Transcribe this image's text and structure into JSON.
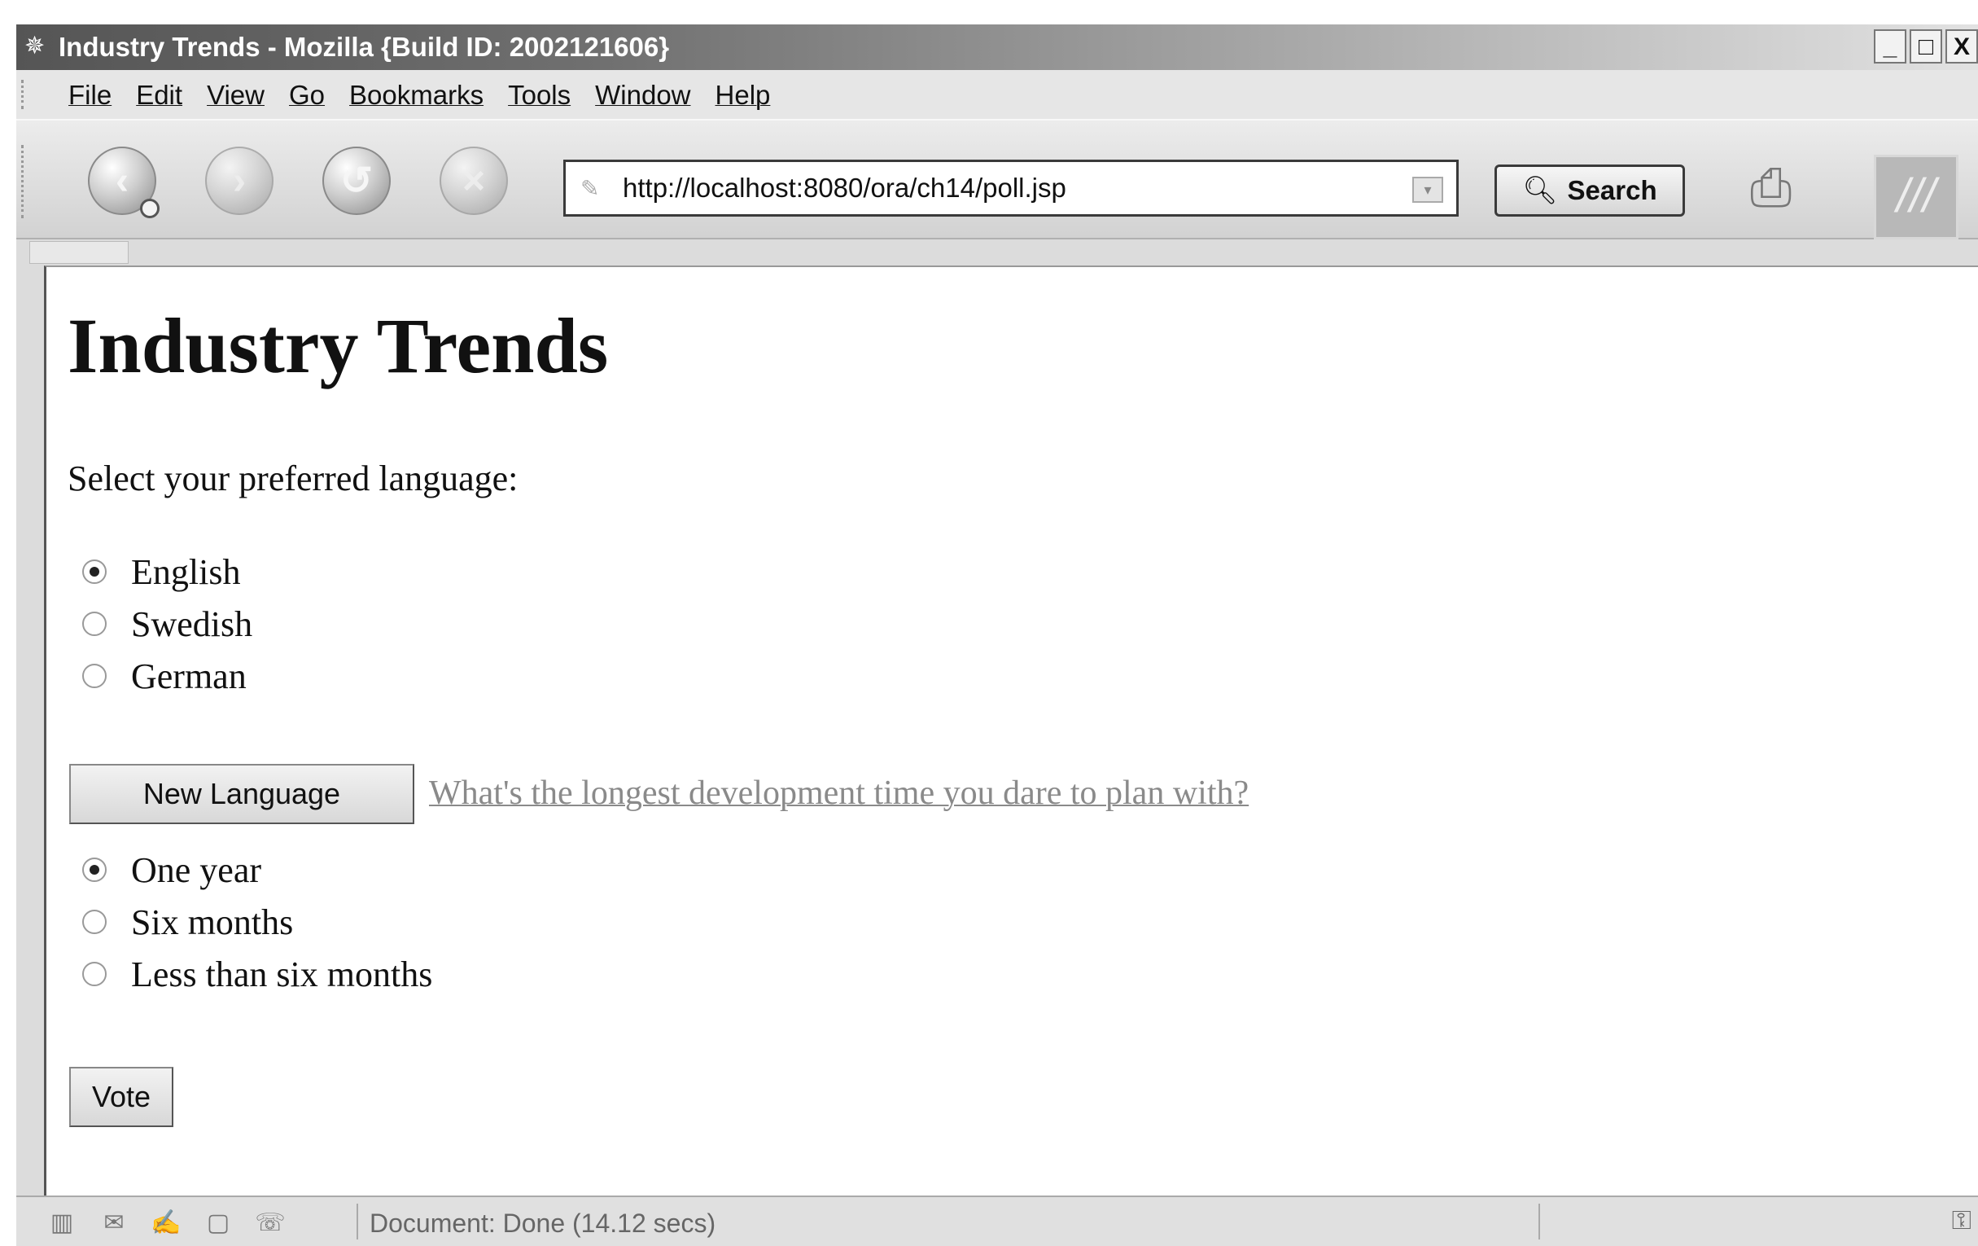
{
  "window": {
    "title": "Industry Trends - Mozilla {Build ID: 2002121606}",
    "minimize": "_",
    "maximize": "□",
    "close": "X"
  },
  "menu": [
    "File",
    "Edit",
    "View",
    "Go",
    "Bookmarks",
    "Tools",
    "Window",
    "Help"
  ],
  "toolbar": {
    "url": "http://localhost:8080/ora/ch14/poll.jsp",
    "search_label": "Search",
    "icons": [
      "back-icon",
      "forward-icon",
      "reload-icon",
      "stop-icon",
      "print-icon",
      "throbber-icon"
    ]
  },
  "page": {
    "heading": "Industry Trends",
    "language_prompt": "Select your preferred language:",
    "languages": [
      {
        "label": "English",
        "checked": true
      },
      {
        "label": "Swedish",
        "checked": false
      },
      {
        "label": "German",
        "checked": false
      }
    ],
    "new_language_button": "New Language",
    "question_link": "What's the longest development time you dare to plan with?",
    "time_options": [
      {
        "label": "One year",
        "checked": true
      },
      {
        "label": "Six months",
        "checked": false
      },
      {
        "label": "Less than six months",
        "checked": false
      }
    ],
    "vote_button": "Vote"
  },
  "status": {
    "text": "Document: Done (14.12 secs)"
  },
  "colors": {
    "link": "#8a8a8a",
    "title_bar_start": "#555555",
    "content_background": "#ffffff"
  }
}
